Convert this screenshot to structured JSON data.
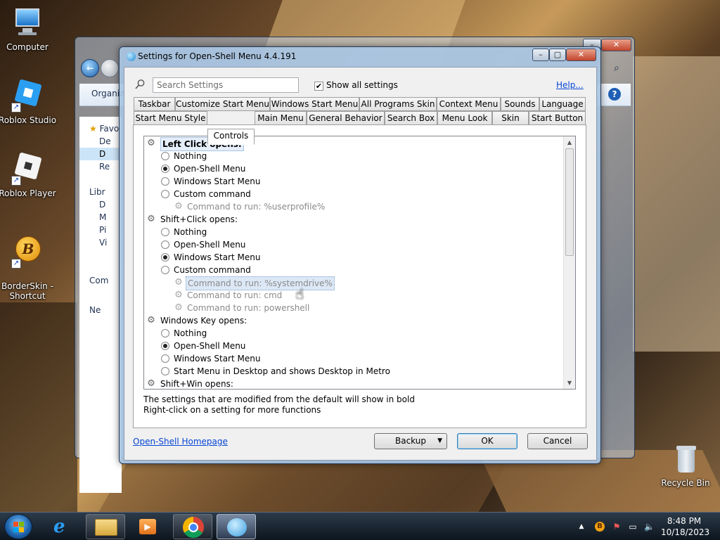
{
  "desktop": {
    "icons": [
      {
        "label": "Computer"
      },
      {
        "label": "Roblox Studio"
      },
      {
        "label": "Roblox Player"
      },
      {
        "label": "BorderSkin -\nShortcut"
      },
      {
        "label": "Recycle Bin"
      }
    ]
  },
  "explorer": {
    "toolbar_label": "Organiz",
    "sidebar": [
      "Favo",
      "De",
      "D",
      "Re",
      "Libr",
      "D",
      "M",
      "Pi",
      "Vi",
      "Com",
      "Ne"
    ]
  },
  "dialog": {
    "title": "Settings for Open-Shell Menu 4.4.191",
    "search_placeholder": "Search Settings",
    "show_all_label": "Show all settings",
    "show_all_checked": true,
    "help_link": "Help...",
    "tabs_row1": [
      "Taskbar",
      "Customize Start Menu",
      "Windows Start Menu",
      "All Programs Skin",
      "Context Menu",
      "Sounds",
      "Language"
    ],
    "tabs_row2": [
      "Start Menu Style",
      "Controls",
      "Main Menu",
      "General Behavior",
      "Search Box",
      "Menu Look",
      "Skin",
      "Start Button"
    ],
    "active_tab": "Controls",
    "tree": [
      {
        "type": "group",
        "label": "Left Click opens:",
        "bold": true
      },
      {
        "type": "radio",
        "label": "Nothing",
        "checked": false
      },
      {
        "type": "radio",
        "label": "Open-Shell Menu",
        "checked": true
      },
      {
        "type": "radio",
        "label": "Windows Start Menu",
        "checked": false
      },
      {
        "type": "radio",
        "label": "Custom command",
        "checked": false
      },
      {
        "type": "cmd",
        "label": "Command to run: %userprofile%"
      },
      {
        "type": "group",
        "label": "Shift+Click opens:",
        "bold": false
      },
      {
        "type": "radio",
        "label": "Nothing",
        "checked": false
      },
      {
        "type": "radio",
        "label": "Open-Shell Menu",
        "checked": false
      },
      {
        "type": "radio",
        "label": "Windows Start Menu",
        "checked": true
      },
      {
        "type": "radio",
        "label": "Custom command",
        "checked": false
      },
      {
        "type": "cmd",
        "label": "Command to run: %systemdrive%",
        "selected": true
      },
      {
        "type": "cmd",
        "label": "Command to run: cmd"
      },
      {
        "type": "cmd",
        "label": "Command to run: powershell"
      },
      {
        "type": "group",
        "label": "Windows Key opens:",
        "bold": false
      },
      {
        "type": "radio",
        "label": "Nothing",
        "checked": false
      },
      {
        "type": "radio",
        "label": "Open-Shell Menu",
        "checked": true
      },
      {
        "type": "radio",
        "label": "Windows Start Menu",
        "checked": false
      },
      {
        "type": "radio",
        "label": "Start Menu in Desktop and shows Desktop in Metro",
        "checked": false
      },
      {
        "type": "group",
        "label": "Shift+Win opens:",
        "bold": false
      }
    ],
    "hint_line1": "The settings that are modified from the default will show in bold",
    "hint_line2": "Right-click on a setting for more functions",
    "homepage_link": "Open-Shell Homepage",
    "backup_label": "Backup",
    "ok_label": "OK",
    "cancel_label": "Cancel"
  },
  "taskbar": {
    "time": "8:48 PM",
    "date": "10/18/2023",
    "pinned": [
      "internet-explorer-icon",
      "file-explorer-icon",
      "media-player-icon",
      "chrome-icon",
      "open-shell-icon"
    ]
  }
}
